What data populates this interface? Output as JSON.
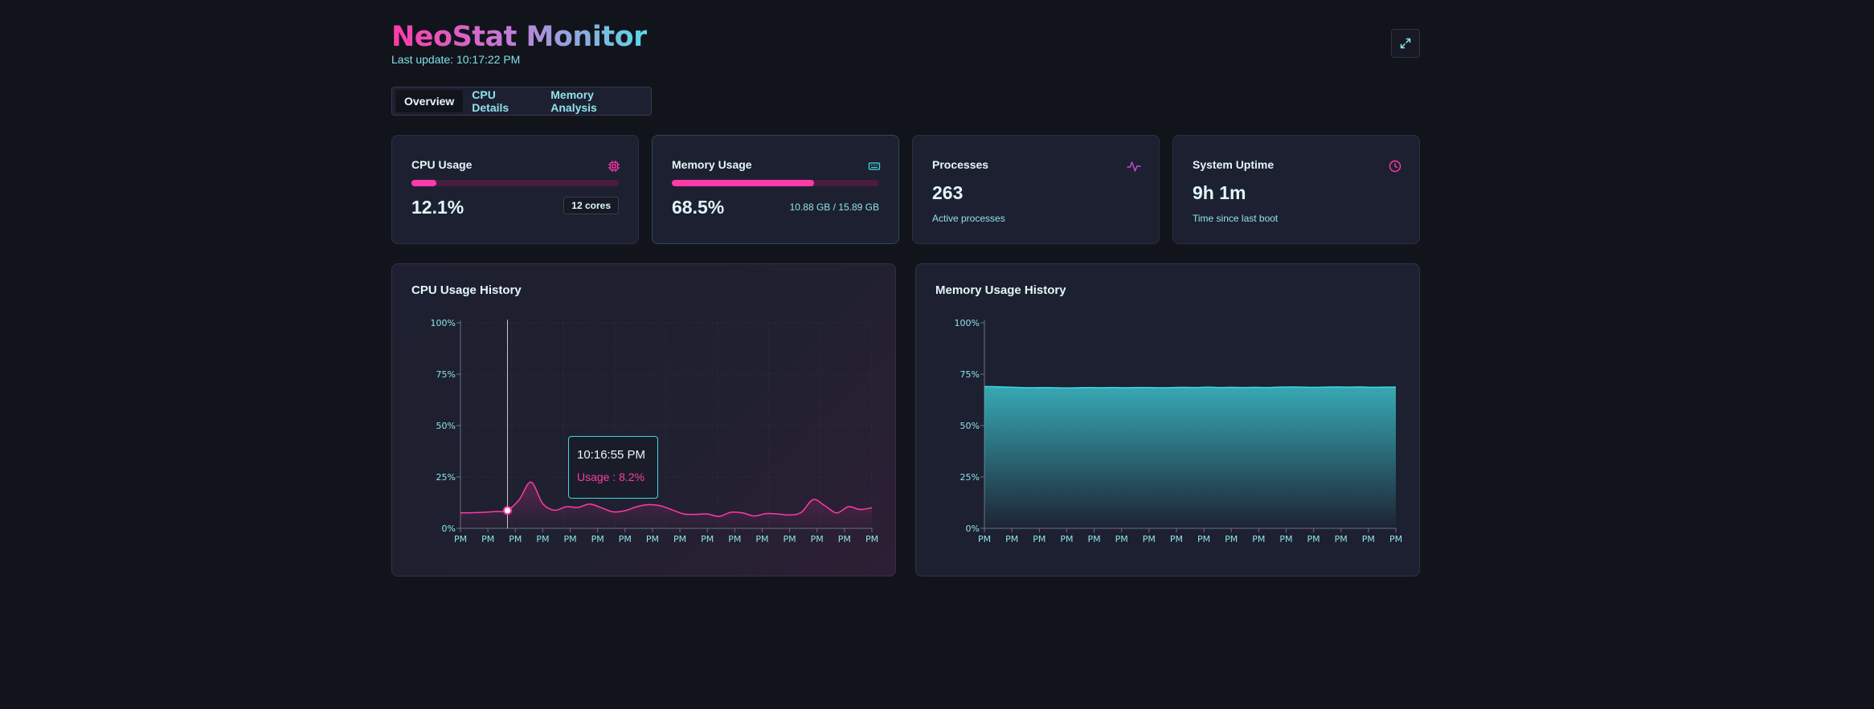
{
  "header": {
    "title": "NeoStat Monitor",
    "last_update": "Last update: 10:17:22 PM",
    "expand_icon": "expand-icon"
  },
  "tabs": [
    {
      "label": "Overview",
      "active": true
    },
    {
      "label": "CPU Details",
      "active": false
    },
    {
      "label": "Memory Analysis",
      "active": false
    }
  ],
  "cards": {
    "cpu": {
      "label": "CPU Usage",
      "value": "12.1%",
      "fraction": 0.121,
      "badge": "12 cores",
      "icon": "cpu-chip-icon"
    },
    "memory": {
      "label": "Memory Usage",
      "value": "68.5%",
      "fraction": 0.685,
      "detail": "10.88 GB / 15.89 GB",
      "icon": "memory-icon"
    },
    "processes": {
      "label": "Processes",
      "value": "263",
      "caption": "Active processes",
      "icon": "activity-icon"
    },
    "uptime": {
      "label": "System Uptime",
      "value": "9h 1m",
      "caption": "Time since last boot",
      "icon": "clock-icon"
    }
  },
  "colors": {
    "accent_pink": "#ff3aa8",
    "accent_teal": "#3fd6e0",
    "background": "#12141c",
    "card": "#1d2030"
  },
  "tooltip": {
    "time": "10:16:55 PM",
    "usage": "Usage : 8.2%"
  },
  "chart_data": [
    {
      "type": "area",
      "title": "CPU Usage History",
      "xlabel": "",
      "ylabel": "",
      "ylim": [
        0,
        100
      ],
      "yticks": [
        "0%",
        "25%",
        "50%",
        "75%",
        "100%"
      ],
      "x_tick_labels": [
        "PM",
        "PM",
        "PM",
        "PM",
        "PM",
        "PM",
        "PM",
        "PM",
        "PM",
        "PM",
        "PM",
        "PM",
        "PM",
        "PM",
        "PM",
        "PM"
      ],
      "grid": true,
      "series": [
        {
          "values": [
            7.5,
            7.6,
            7.8,
            8.2,
            8.7,
            14.0,
            22.5,
            12.0,
            8.8,
            10.5,
            10.2,
            11.8,
            10.0,
            8.0,
            8.6,
            10.5,
            11.5,
            11.0,
            9.0,
            7.0,
            6.8,
            7.0,
            5.8,
            7.8,
            7.5,
            6.0,
            7.2,
            7.0,
            6.5,
            7.8,
            14.0,
            11.0,
            7.5,
            10.5,
            9.2,
            10.0
          ],
          "color": "#ff3aa8"
        }
      ],
      "highlight_index": 4,
      "highlight_value": 8.2
    },
    {
      "type": "area",
      "title": "Memory Usage History",
      "xlabel": "",
      "ylabel": "",
      "ylim": [
        0,
        100
      ],
      "yticks": [
        "0%",
        "25%",
        "50%",
        "75%",
        "100%"
      ],
      "x_tick_labels": [
        "PM",
        "PM",
        "PM",
        "PM",
        "PM",
        "PM",
        "PM",
        "PM",
        "PM",
        "PM",
        "PM",
        "PM",
        "PM",
        "PM",
        "PM",
        "PM"
      ],
      "grid": false,
      "series": [
        {
          "values": [
            69.0,
            68.9,
            68.7,
            68.5,
            68.4,
            68.5,
            68.4,
            68.3,
            68.4,
            68.5,
            68.4,
            68.5,
            68.4,
            68.5,
            68.5,
            68.4,
            68.5,
            68.6,
            68.5,
            68.7,
            68.5,
            68.6,
            68.5,
            68.6,
            68.5,
            68.7,
            68.8,
            68.7,
            68.6,
            68.7,
            68.8,
            68.7,
            68.8,
            68.6,
            68.7,
            68.7
          ],
          "color": "#3fd6e0"
        }
      ]
    }
  ]
}
